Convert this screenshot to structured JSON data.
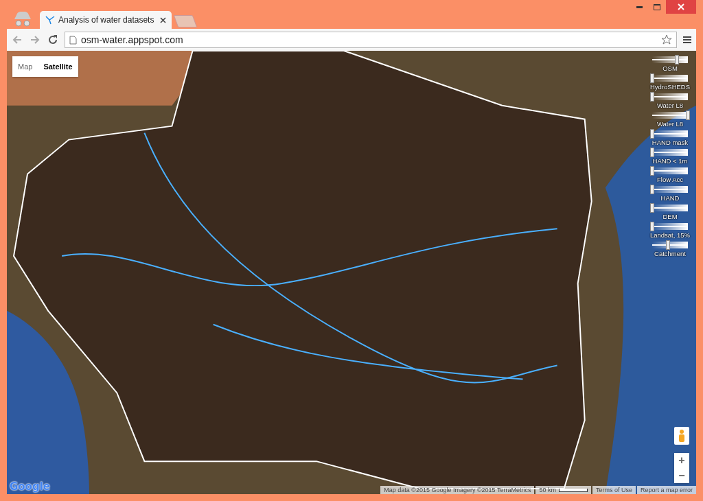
{
  "browser": {
    "tab_title": "Analysis of water datasets",
    "address": "osm-water.appspot.com"
  },
  "map_type": [
    {
      "label": "Map",
      "selected": false
    },
    {
      "label": "Satellite",
      "selected": true
    }
  ],
  "layers": [
    {
      "label": "OSM",
      "level": 0.7
    },
    {
      "label": "HydroSHEDS",
      "level": 0
    },
    {
      "label": "Water L8",
      "level": 0
    },
    {
      "label": "Water L8",
      "level": 1
    },
    {
      "label": "HAND mask",
      "level": 0
    },
    {
      "label": "HAND < 1m",
      "level": 0
    },
    {
      "label": "Flow Acc",
      "level": 0
    },
    {
      "label": "HAND",
      "level": 0
    },
    {
      "label": "DEM",
      "level": 0
    },
    {
      "label": "Landsat, 15%",
      "level": 0
    },
    {
      "label": "Catchment",
      "level": 0.45
    }
  ],
  "zoom": {
    "in": "+",
    "out": "−"
  },
  "logo": "Google",
  "attribution": {
    "map_data": "Map data ©2015 Google Imagery ©2015 TerraMetrics",
    "scale": "50 km",
    "terms": "Terms of Use",
    "report": "Report a map error"
  }
}
